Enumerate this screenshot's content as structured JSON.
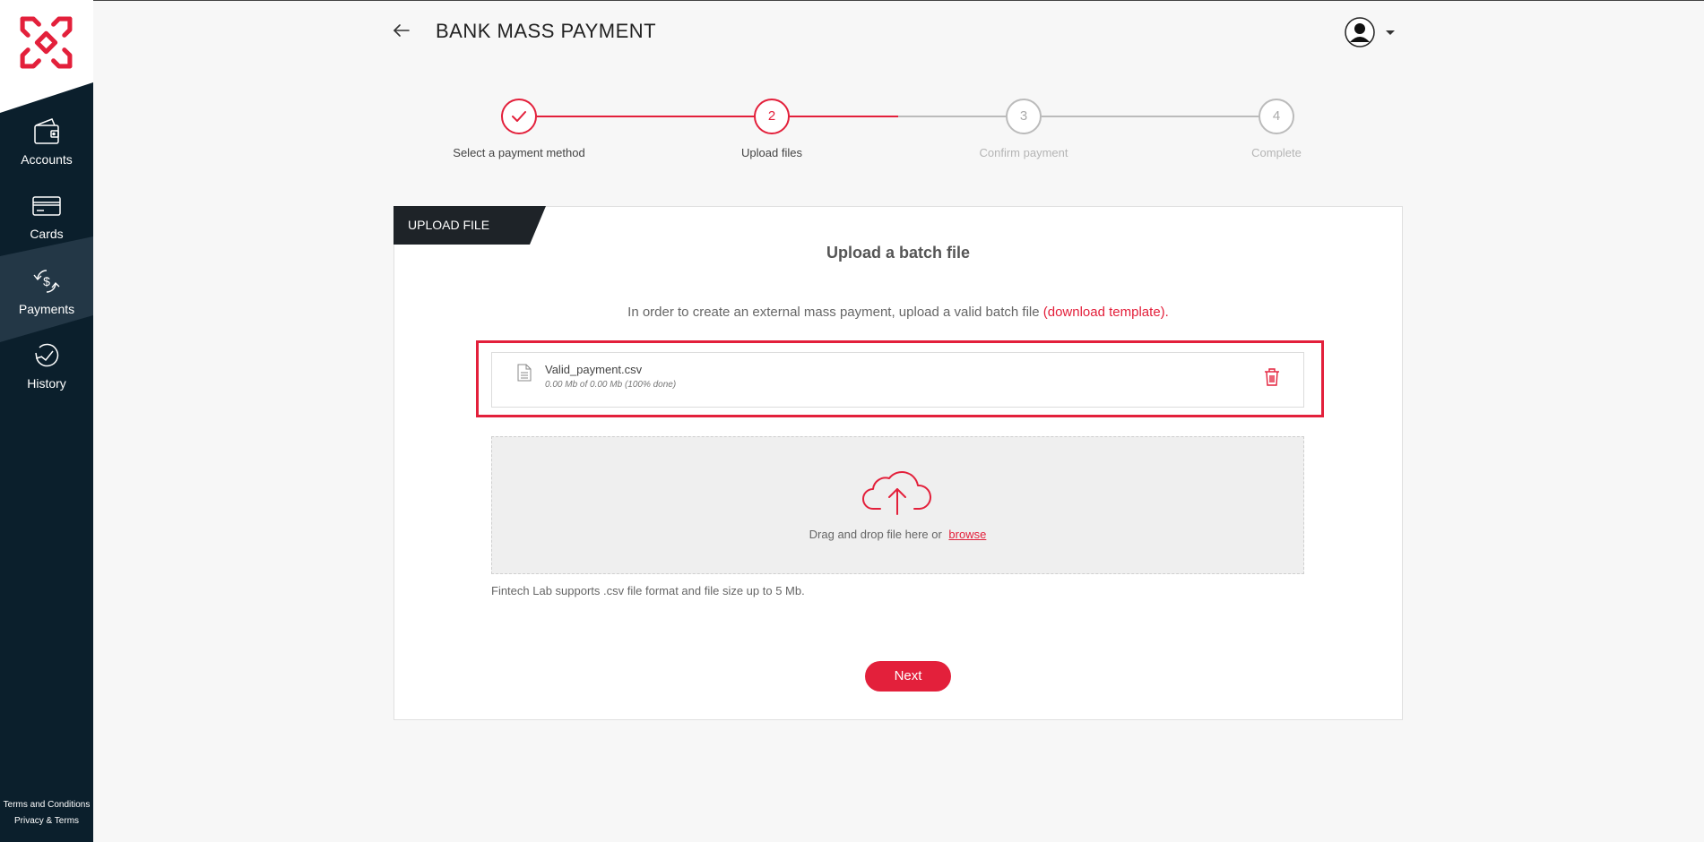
{
  "sidebar": {
    "logo": "fintech-logo",
    "items": [
      {
        "label": "Accounts",
        "icon": "wallet-icon"
      },
      {
        "label": "Cards",
        "icon": "card-icon"
      },
      {
        "label": "Payments",
        "icon": "exchange-dollar-icon",
        "active": true
      },
      {
        "label": "History",
        "icon": "history-icon"
      }
    ],
    "footer": {
      "terms": "Terms and Conditions",
      "privacy": "Privacy & Terms"
    }
  },
  "header": {
    "title": "BANK MASS PAYMENT"
  },
  "steps": [
    {
      "number": "",
      "label": "Select a payment method",
      "state": "done"
    },
    {
      "number": "2",
      "label": "Upload files",
      "state": "current"
    },
    {
      "number": "3",
      "label": "Confirm payment",
      "state": "pending"
    },
    {
      "number": "4",
      "label": "Complete",
      "state": "pending"
    }
  ],
  "card": {
    "tab": "UPLOAD FILE",
    "heading": "Upload a batch file",
    "description": "In order to create an external mass payment, upload a valid batch file ",
    "template_link": "(download template).",
    "file": {
      "name": "Valid_payment.csv",
      "progress": "0.00 Mb of 0.00 Mb (100% done)"
    },
    "dropzone": {
      "text": "Drag and drop file here or ",
      "browse": "browse"
    },
    "support": "Fintech Lab supports .csv file format and file size up to 5 Mb.",
    "next": "Next"
  },
  "colors": {
    "accent": "#e3203b",
    "sidebar": "#0b1f2c",
    "tab": "#1e2328"
  }
}
